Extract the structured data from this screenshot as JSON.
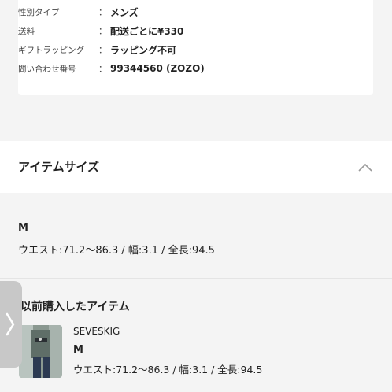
{
  "specs": [
    {
      "label": "性別タイプ",
      "sep": "：",
      "value": "メンズ"
    },
    {
      "label": "送料",
      "sep": "：",
      "value": "配送ごとに¥330"
    },
    {
      "label": "ギフトラッピング",
      "sep": "：",
      "value": "ラッピング不可"
    },
    {
      "label": "問い合わせ番号",
      "sep": "：",
      "value": "99344560 (ZOZO)"
    }
  ],
  "item_size": {
    "title": "アイテムサイズ",
    "size": "M",
    "detail": "ウエスト:71.2～86.3 / 幅:3.1 / 全長:94.5"
  },
  "previous_purchase": {
    "title": "以前購入したアイテム",
    "brand": "SEVESKIG",
    "size": "M",
    "detail": "ウエスト:71.2～86.3 / 幅:3.1 / 全長:94.5"
  },
  "icons": {
    "collapse": "chevron-up-icon",
    "side_tab": "chevron-right-icon"
  }
}
